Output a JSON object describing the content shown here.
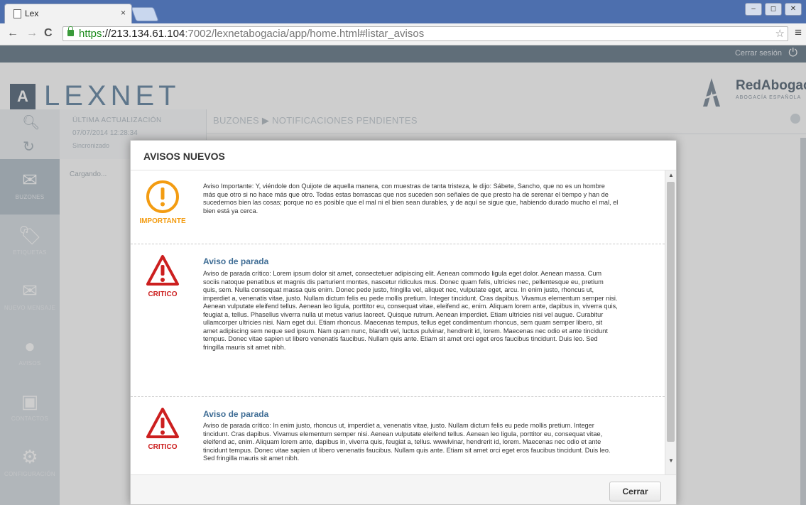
{
  "browser": {
    "tab_title": "Lex",
    "tab_close": "×",
    "url_scheme": "https",
    "url_host": "://213.134.61.104",
    "url_rest": ":7002/lexnetabogacia/app/home.html#listar_avisos",
    "window_buttons": [
      "–",
      "◻",
      "✕"
    ]
  },
  "app": {
    "logout_label": "Cerrar sesión",
    "logo_mark": "A",
    "logo_text": "LEXNET",
    "brand_name": "RedAbogacía",
    "brand_sub": "ABOGACÍA ESPAÑOLA",
    "last_update_label": "ÚLTIMA ACTUALIZACIÓN",
    "last_update_value": "07/07/2014 12:28:34",
    "sync_label": "Sincronizado",
    "loading_text": "Cargando...",
    "breadcrumb_section": "BUZONES",
    "breadcrumb_page": "NOTIFICACIONES PENDIENTES",
    "sidebar": [
      {
        "label": "BUZONES",
        "icon": "inbox-icon"
      },
      {
        "label": "ETIQUETAS",
        "icon": "tag-icon"
      },
      {
        "label": "NUEVO MENSAJE",
        "icon": "new-message-icon"
      },
      {
        "label": "AVISOS",
        "icon": "notice-icon"
      },
      {
        "label": "CONTACTOS",
        "icon": "contacts-icon"
      },
      {
        "label": "CONFIGURACIÓN",
        "icon": "gear-icon"
      }
    ]
  },
  "modal": {
    "title": "AVISOS NUEVOS",
    "close_label": "Cerrar",
    "notices": [
      {
        "type_label": "IMPORTANTE",
        "title": "",
        "text": "Aviso Importante: Y, viéndole don Quijote de aquella manera, con muestras de tanta tristeza, le dijo: Sábete, Sancho, que no es un hombre más que otro si no hace más que otro. Todas estas borrascas que nos suceden son señales de que presto ha de serenar el tiempo y han de sucedernos bien las cosas; porque no es posible que el mal ni el bien sean durables, y de aquí se sigue que, habiendo durado mucho el mal, el bien está ya cerca."
      },
      {
        "type_label": "CRITICO",
        "title": "Aviso de parada",
        "text": "Aviso de parada crítico: Lorem ipsum dolor sit amet, consectetuer adipiscing elit. Aenean commodo ligula eget dolor. Aenean massa. Cum sociis natoque penatibus et magnis dis parturient montes, nascetur ridiculus mus. Donec quam felis, ultricies nec, pellentesque eu, pretium quis, sem. Nulla consequat massa quis enim. Donec pede justo, fringilla vel, aliquet nec, vulputate eget, arcu. In enim justo, rhoncus ut, imperdiet a, venenatis vitae, justo. Nullam dictum felis eu pede mollis pretium. Integer tincidunt. Cras dapibus. Vivamus elementum semper nisi. Aenean vulputate eleifend tellus. Aenean leo ligula, porttitor eu, consequat vitae, eleifend ac, enim. Aliquam lorem ante, dapibus in, viverra quis, feugiat a, tellus. Phasellus viverra nulla ut metus varius laoreet. Quisque rutrum. Aenean imperdiet. Etiam ultricies nisi vel augue. Curabitur ullamcorper ultricies nisi. Nam eget dui. Etiam rhoncus. Maecenas tempus, tellus eget condimentum rhoncus, sem quam semper libero, sit amet adipiscing sem neque sed ipsum. Nam quam nunc, blandit vel, luctus pulvinar, hendrerit id, lorem. Maecenas nec odio et ante tincidunt tempus. Donec vitae sapien ut libero venenatis faucibus. Nullam quis ante. Etiam sit amet orci eget eros faucibus tincidunt. Duis leo. Sed fringilla mauris sit amet nibh."
      },
      {
        "type_label": "CRITICO",
        "title": "Aviso de parada",
        "text": "Aviso de parada crítico: In enim justo, rhoncus ut, imperdiet a, venenatis vitae, justo. Nullam dictum felis eu pede mollis pretium. Integer tincidunt. Cras dapibus. Vivamus elementum semper nisi. Aenean vulputate eleifend tellus. Aenean leo ligula, porttitor eu, consequat vitae, eleifend ac, enim. Aliquam lorem ante, dapibus in, viverra quis, feugiat a, tellus. wwwlvinar, hendrerit id, lorem. Maecenas nec odio et ante tincidunt tempus. Donec vitae sapien ut libero venenatis faucibus. Nullam quis ante. Etiam sit amet orci eget eros faucibus tincidunt. Duis leo. Sed fringilla mauris sit amet nibh."
      }
    ]
  },
  "colors": {
    "important": "#f39c12",
    "critical": "#cc1f1f",
    "notice_title": "#3f6d95"
  }
}
